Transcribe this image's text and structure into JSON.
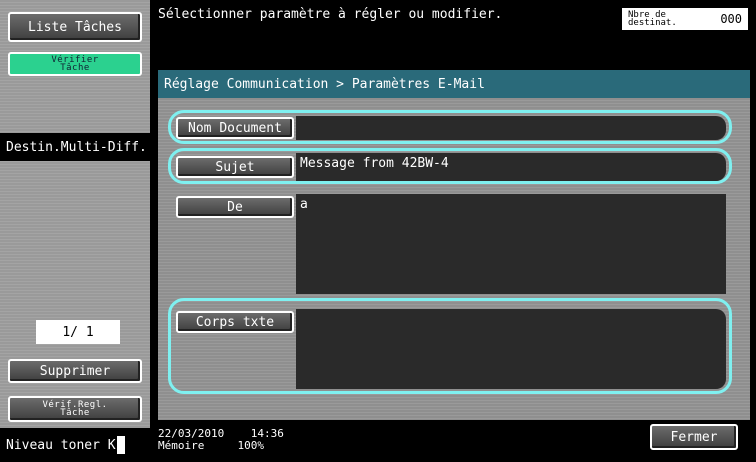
{
  "sidebar": {
    "liste_taches": "Liste Tâches",
    "verifier_tache_line1": "Vérifier",
    "verifier_tache_line2": "Tâche",
    "destin_multi_diff": "Destin.Multi-Diff.",
    "page_indicator": "1/  1",
    "supprimer": "Supprimer",
    "verif_regl_line1": "Vérif.Regl.",
    "verif_regl_line2": "Tâche",
    "toner_label": "Niveau toner",
    "toner_color": "K"
  },
  "header": {
    "instruction": "Sélectionner paramètre à régler ou modifier.",
    "count_label_line1": "Nbre de",
    "count_label_line2": "destinat.",
    "count_value": "000"
  },
  "panel": {
    "breadcrumb": "Réglage Communication > Paramètres E-Mail",
    "fields": [
      {
        "label": "Nom Document",
        "value": ""
      },
      {
        "label": "Sujet",
        "value": "Message from 42BW-4"
      },
      {
        "label": "De",
        "value": "a"
      },
      {
        "label": "Corps txte",
        "value": ""
      }
    ]
  },
  "footer": {
    "date": "22/03/2010",
    "time": "14:36",
    "memory_label": "Mémoire",
    "memory_value": "100%",
    "close_label": "Fermer"
  },
  "colors": {
    "accent_green": "#2bd18f",
    "selection_cyan": "#7ff0f0",
    "breadcrumb_teal": "#2a6a7a"
  }
}
